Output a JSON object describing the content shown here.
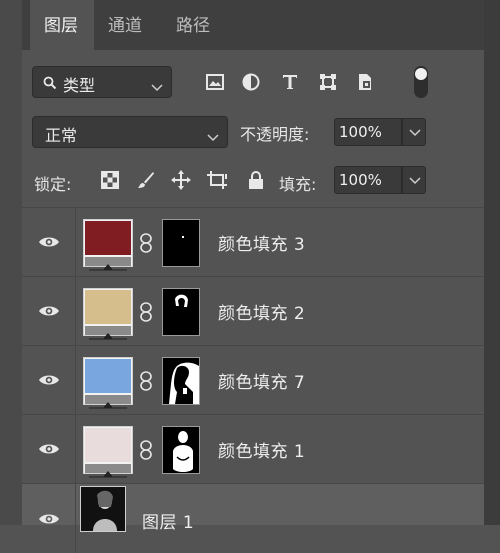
{
  "tabs": [
    {
      "label": "图层",
      "active": true
    },
    {
      "label": "通道",
      "active": false
    },
    {
      "label": "路径",
      "active": false
    }
  ],
  "filter": {
    "type_label": "类型"
  },
  "filter_icons": [
    "image-filter-icon",
    "adjustment-filter-icon",
    "type-filter-icon",
    "shape-filter-icon",
    "smart-object-filter-icon"
  ],
  "blend": {
    "mode": "正常",
    "opacity_label": "不透明度:",
    "opacity_value": "100%"
  },
  "lock": {
    "label": "锁定:",
    "fill_label": "填充:",
    "fill_value": "100%"
  },
  "layers": [
    {
      "name": "颜色填充 3",
      "color": "#7f1d22"
    },
    {
      "name": "颜色填充 2",
      "color": "#d6bd8c"
    },
    {
      "name": "颜色填充 7",
      "color": "#79a6de"
    },
    {
      "name": "颜色填充 1",
      "color": "#e8dcdd"
    },
    {
      "name": "图层 1"
    }
  ]
}
